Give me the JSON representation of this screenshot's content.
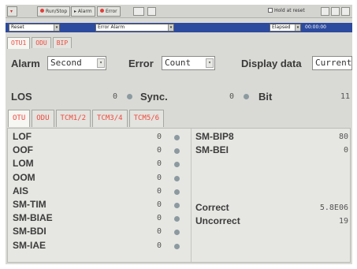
{
  "toolbar": {
    "run_stop": "Run/Stop",
    "alarm": "Alarm",
    "error": "Error",
    "hold": "Hold at reset"
  },
  "bluebar": {
    "select1": "Reset",
    "select2": "Error Alarm",
    "elapsed": "Elapsed",
    "time": "00:00:00"
  },
  "tabs_top": [
    "OTU1",
    "ODU",
    "BIP"
  ],
  "controls": {
    "alarm_label": "Alarm",
    "alarm_value": "Second",
    "error_label": "Error",
    "error_value": "Count",
    "display_label": "Display data",
    "display_value": "Current"
  },
  "status": {
    "los_label": "LOS",
    "los_value": "0",
    "sync_label": "Sync.",
    "sync_value": "0",
    "bit_label": "Bit",
    "bit_value": "11"
  },
  "tabs_sub": [
    "OTU",
    "ODU",
    "TCM1/2",
    "TCM3/4",
    "TCM5/6"
  ],
  "alarms": [
    {
      "label": "LOF",
      "value": "0"
    },
    {
      "label": "OOF",
      "value": "0"
    },
    {
      "label": "LOM",
      "value": "0"
    },
    {
      "label": "OOM",
      "value": "0"
    },
    {
      "label": "AIS",
      "value": "0"
    },
    {
      "label": "SM-TIM",
      "value": "0"
    },
    {
      "label": "SM-BIAE",
      "value": "0"
    },
    {
      "label": "SM-BDI",
      "value": "0"
    },
    {
      "label": "SM-IAE",
      "value": "0"
    }
  ],
  "errors": [
    {
      "label": "SM-BIP8",
      "value": "80"
    },
    {
      "label": "SM-BEI",
      "value": "0"
    }
  ],
  "fec": [
    {
      "label": "Correct",
      "value": "5.8E06"
    },
    {
      "label": "Uncorrect",
      "value": "19"
    }
  ],
  "colors": {
    "tab_text": "#f04a3c",
    "led_off": "#8c9aa0",
    "title_bar": "#2c4a9e"
  }
}
